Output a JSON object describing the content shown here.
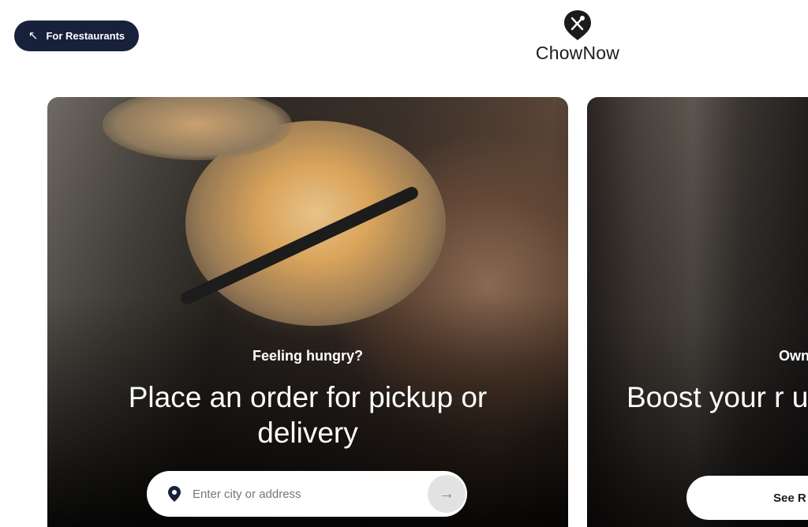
{
  "header": {
    "for_restaurants_label": "For Restaurants",
    "brand_name": "ChowNow"
  },
  "cards": {
    "left": {
      "kicker": "Feeling hungry?",
      "headline": "Place an order for pickup or delivery",
      "search_placeholder": "Enter city or address"
    },
    "right": {
      "kicker": "Own",
      "headline": "Boost your r up",
      "button_label": "See R"
    }
  },
  "colors": {
    "primary_navy": "#17213b",
    "button_grey": "#e2e2e2"
  },
  "icons": {
    "for_restaurants": "arrow-up-left-icon",
    "logo": "fork-knife-pin-icon",
    "search_location": "location-pin-icon",
    "search_go": "arrow-right-icon"
  }
}
